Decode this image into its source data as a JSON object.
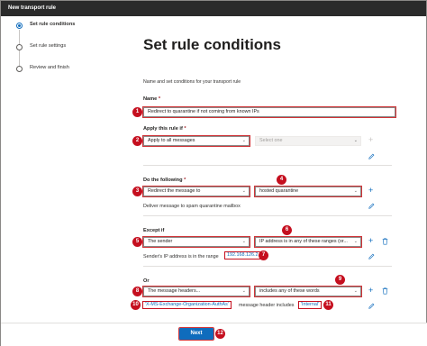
{
  "window": {
    "title": "New transport rule"
  },
  "steps": [
    {
      "label": "Set rule conditions",
      "state": "current"
    },
    {
      "label": "Set rule settings",
      "state": "pending"
    },
    {
      "label": "Review and finish",
      "state": "pending"
    }
  ],
  "page": {
    "title": "Set rule conditions",
    "description": "Name and set conditions for your transport rule"
  },
  "name_field": {
    "label": "Name",
    "required_mark": "*",
    "value": "Redirect to quarantine if not coming from known IPs",
    "badge": "1"
  },
  "apply_rule": {
    "label": "Apply this rule if",
    "required_mark": "*",
    "condition": "Apply to all messages",
    "condition_badge": "2",
    "secondary_placeholder": "Select one"
  },
  "do_following": {
    "label": "Do the following",
    "required_mark": "*",
    "action": "Redirect the message to",
    "action_badge": "3",
    "target": "hosted quarantine",
    "target_badge": "4",
    "summary": "Deliver message to spam quarantine mailbox"
  },
  "except_if": {
    "label": "Except if",
    "subject": "The sender",
    "subject_badge": "5",
    "predicate": "IP address is in any of these ranges (or...",
    "predicate_badge": "6",
    "summary_prefix": "Sender's IP address is in the range",
    "summary_value": "192.168.126.2",
    "summary_badge": "7"
  },
  "or_group": {
    "label": "Or",
    "subject": "The message headers...",
    "subject_badge": "8",
    "predicate": "includes any of these words",
    "predicate_badge": "9",
    "header_value": "'X-MS-Exchange-Organization-AuthAs'",
    "header_badge": "10",
    "summary_middle": "message header includes",
    "word_value": "'Internal'",
    "word_badge": "11"
  },
  "footer": {
    "next_label": "Next",
    "next_badge": "12"
  },
  "colors": {
    "accent": "#0f6cbd",
    "highlight": "#c50f1f",
    "titlebar": "#2b2b2b"
  },
  "icons": {
    "add": "plus-icon",
    "edit": "pencil-icon",
    "delete": "trash-icon",
    "dropdown": "chevron-down-icon"
  }
}
